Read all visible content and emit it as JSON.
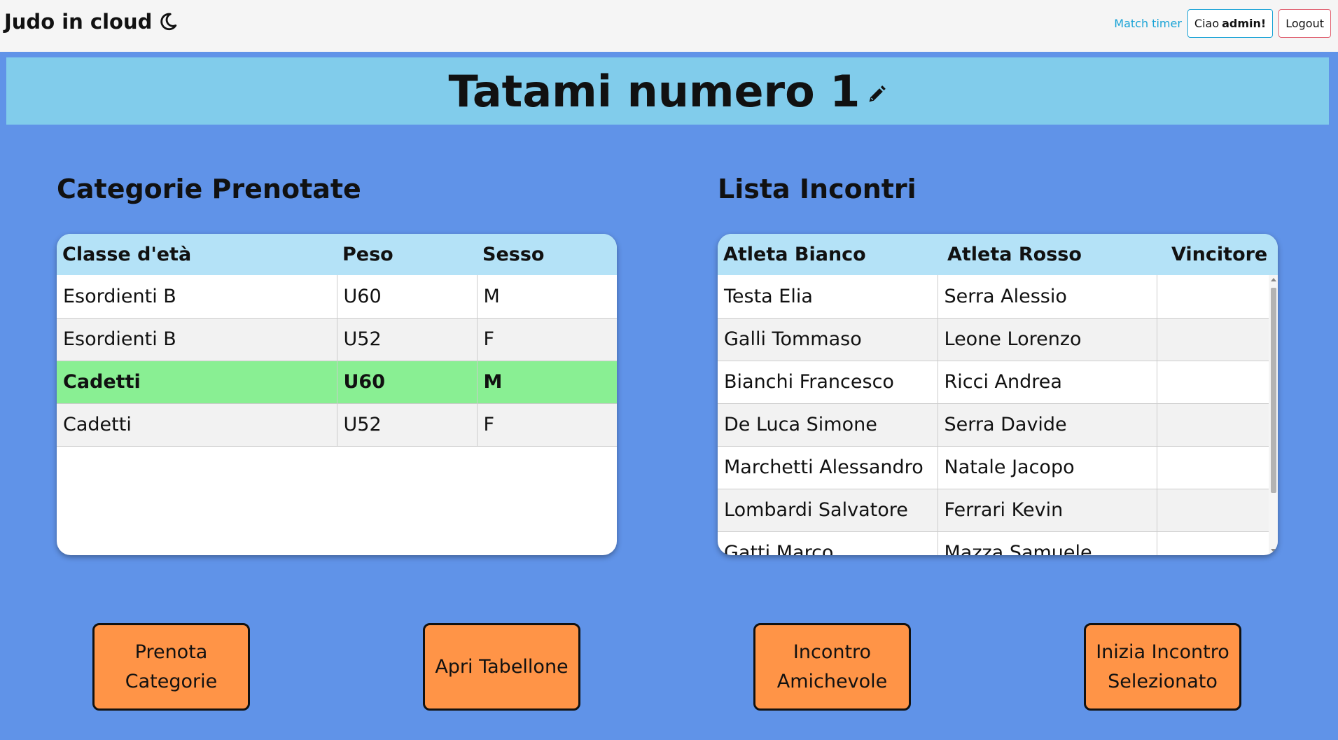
{
  "navbar": {
    "brand": "Judo in cloud",
    "match_timer": "Match timer",
    "greeting": "Ciao",
    "username": "admin!",
    "logout": "Logout"
  },
  "page_title": "Tatami numero 1",
  "categories": {
    "title": "Categorie Prenotate",
    "headers": [
      "Classe d'età",
      "Peso",
      "Sesso"
    ],
    "rows": [
      [
        "Esordienti B",
        "U60",
        "M"
      ],
      [
        "Esordienti B",
        "U52",
        "F"
      ],
      [
        "Cadetti",
        "U60",
        "M"
      ],
      [
        "Cadetti",
        "U52",
        "F"
      ]
    ],
    "selected_row": 2
  },
  "matches": {
    "title": "Lista Incontri",
    "headers": [
      "Atleta Bianco",
      "Atleta Rosso",
      "Vincitore"
    ],
    "rows": [
      [
        "Testa Elia",
        "Serra Alessio",
        ""
      ],
      [
        "Galli Tommaso",
        "Leone Lorenzo",
        ""
      ],
      [
        "Bianchi Francesco",
        "Ricci Andrea",
        ""
      ],
      [
        "De Luca Simone",
        "Serra Davide",
        ""
      ],
      [
        "Marchetti Alessandro",
        "Natale Jacopo",
        ""
      ],
      [
        "Lombardi Salvatore",
        "Ferrari Kevin",
        ""
      ],
      [
        "Gatti Marco",
        "Mazza Samuele",
        ""
      ]
    ]
  },
  "actions": {
    "book_categories": "Prenota\nCategorie",
    "open_board": "Apri Tabellone",
    "friendly_match": "Incontro\nAmichevole",
    "start_selected": "Inizia Incontro\nSelezionato"
  },
  "colors": {
    "background": "#6093e8",
    "title_bar": "#81cceb",
    "table_header": "#b4e2f7",
    "selected_row": "#89ef93",
    "action_button": "#ff9447"
  },
  "icons": {
    "brand": "moon-icon",
    "title_edit": "pencil-icon"
  }
}
